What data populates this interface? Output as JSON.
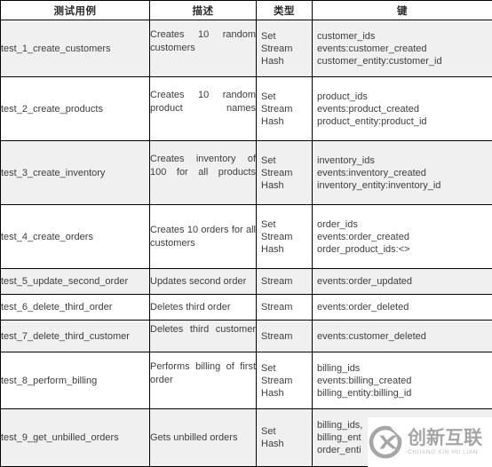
{
  "table": {
    "headers": [
      "测试用例",
      "描述",
      "类型",
      "键"
    ],
    "rows": [
      {
        "case": "test_1_create_customers",
        "description": "Creates 10 random customers",
        "entries": [
          {
            "type": "Set",
            "key": "customer_ids"
          },
          {
            "type": "Stream",
            "key": "events:customer_created"
          },
          {
            "type": "Hash",
            "key": "customer_entity:customer_id"
          }
        ]
      },
      {
        "case": "test_2_create_products",
        "description": "Creates 10 random product names",
        "entries": [
          {
            "type": "Set",
            "key": "product_ids"
          },
          {
            "type": "Stream",
            "key": "events:product_created"
          },
          {
            "type": "Hash",
            "key": "product_entity:product_id"
          }
        ]
      },
      {
        "case": "test_3_create_inventory",
        "description": "Creates inventory of 100 for all products",
        "entries": [
          {
            "type": "Set",
            "key": "inventory_ids"
          },
          {
            "type": "Stream",
            "key": "events:inventory_created"
          },
          {
            "type": "Hash",
            "key": "inventory_entity:inventory_id"
          }
        ]
      },
      {
        "case": "test_4_create_orders",
        "description": "Creates 10 orders for all customers",
        "entries": [
          {
            "type": "Set",
            "key": "order_ids"
          },
          {
            "type": "Stream",
            "key": "events:order_created"
          },
          {
            "type": "Hash",
            "key": "order_product_ids:<>"
          }
        ]
      },
      {
        "case": "test_5_update_second_order",
        "description": "Updates second order",
        "entries": [
          {
            "type": "Stream",
            "key": "events:order_updated"
          }
        ]
      },
      {
        "case": "test_6_delete_third_order",
        "description": "Deletes third order",
        "entries": [
          {
            "type": "Stream",
            "key": "events:order_deleted"
          }
        ]
      },
      {
        "case": "test_7_delete_third_customer",
        "description": "Deletes third customer",
        "entries": [
          {
            "type": "Stream",
            "key": "events:customer_deleted"
          }
        ]
      },
      {
        "case": "test_8_perform_billing",
        "description": "Performs billing of first order",
        "entries": [
          {
            "type": "Set",
            "key": "billing_ids"
          },
          {
            "type": "Stream",
            "key": "events:billing_created"
          },
          {
            "type": "Hash",
            "key": "billing_entity:billing_id"
          }
        ]
      },
      {
        "case": "test_9_get_unbilled_orders",
        "description": "Gets unbilled orders",
        "entries": [
          {
            "type": "Set",
            "key": "billing_ids,"
          },
          {
            "type": "Hash",
            "key": "billing_ent"
          },
          {
            "type": "",
            "key": "order_enti"
          }
        ]
      }
    ]
  },
  "watermark": {
    "logo_icon": "x-circle-logo-icon",
    "chinese_text": "创新互联",
    "pinyin_text": "CHUANG XIN HU LIAN",
    "color": "#a6a6a6"
  },
  "colors": {
    "shaded_row": "#f0f0f0",
    "plain_row": "#ffffff",
    "border": "#000000",
    "text": "#3d3d3d"
  }
}
